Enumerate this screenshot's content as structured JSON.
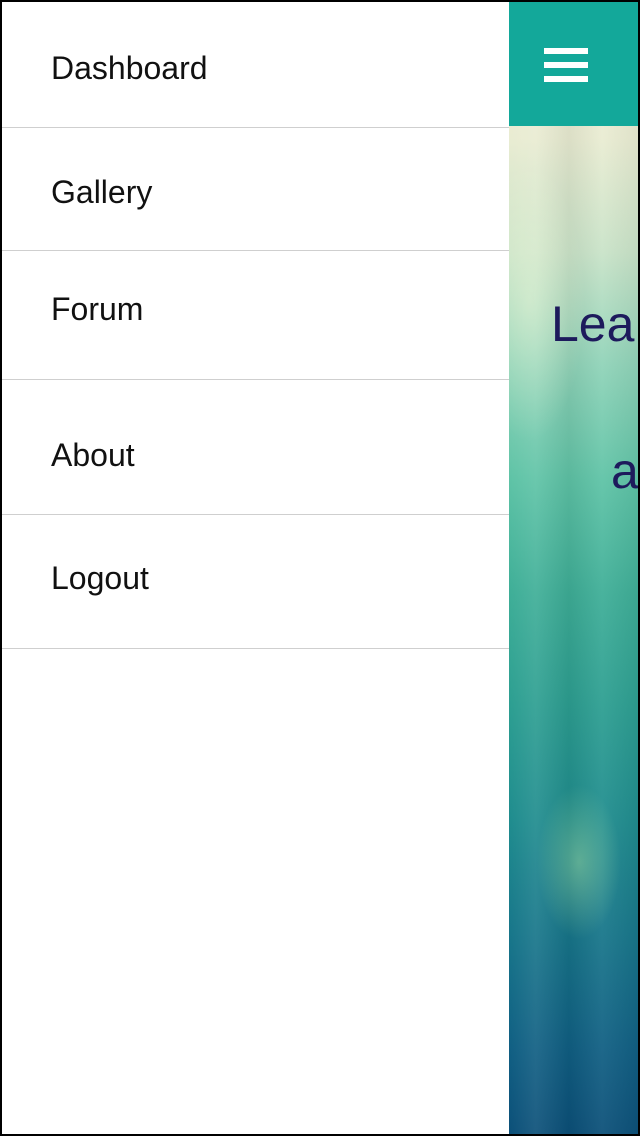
{
  "drawer": {
    "items": [
      {
        "label": "Dashboard"
      },
      {
        "label": "Gallery"
      },
      {
        "label": "Forum"
      },
      {
        "label": "About"
      },
      {
        "label": "Logout"
      }
    ]
  },
  "main": {
    "header": {
      "menu_icon": "hamburger-menu-icon",
      "background_color": "#13a89a"
    },
    "hero": {
      "line1": "Lea",
      "line2": "a",
      "text_color": "#1d1a5c"
    }
  }
}
